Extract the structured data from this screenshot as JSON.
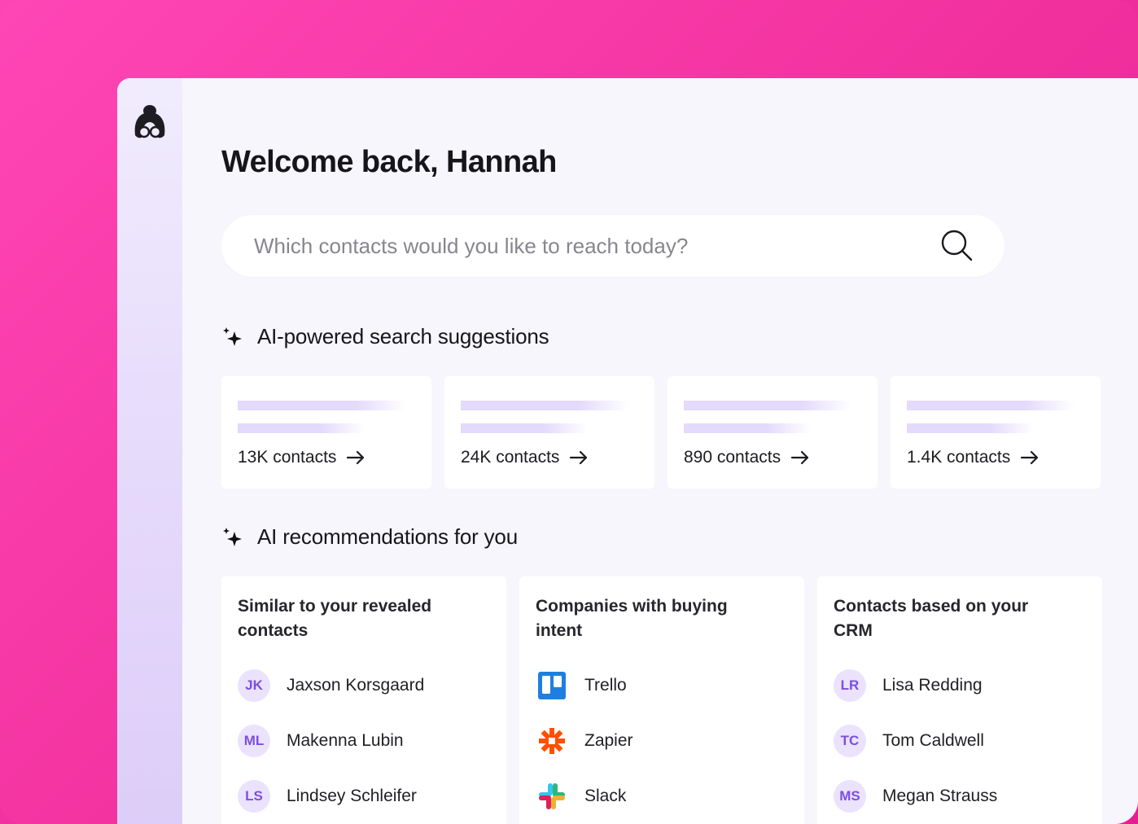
{
  "greeting": "Welcome back, Hannah",
  "search": {
    "placeholder": "Which contacts would you like to reach today?",
    "icon": "search-icon"
  },
  "suggestions": {
    "heading": "AI-powered search suggestions",
    "cards": [
      {
        "label": "13K contacts"
      },
      {
        "label": "24K contacts"
      },
      {
        "label": "890 contacts"
      },
      {
        "label": "1.4K contacts"
      }
    ]
  },
  "recommendations": {
    "heading": "AI recommendations for you",
    "columns": [
      {
        "title": "Similar to your revealed contacts",
        "items": [
          {
            "initials": "JK",
            "name": "Jaxson Korsgaard"
          },
          {
            "initials": "ML",
            "name": "Makenna Lubin"
          },
          {
            "initials": "LS",
            "name": "Lindsey Schleifer"
          }
        ]
      },
      {
        "title": "Companies with buying intent",
        "items": [
          {
            "icon": "trello-logo-icon",
            "name": "Trello"
          },
          {
            "icon": "zapier-logo-icon",
            "name": "Zapier"
          },
          {
            "icon": "slack-logo-icon",
            "name": "Slack"
          }
        ]
      },
      {
        "title": "Contacts based on your CRM",
        "items": [
          {
            "initials": "LR",
            "name": "Lisa Redding"
          },
          {
            "initials": "TC",
            "name": "Tom Caldwell"
          },
          {
            "initials": "MS",
            "name": "Megan Strauss"
          }
        ]
      }
    ]
  },
  "colors": {
    "background_pink": "#f0309e",
    "sidebar_lavender": "#e5d9fb",
    "avatar_bg": "#ebe2fd",
    "avatar_text": "#7c4fe0",
    "trello_blue": "#1f7fe0",
    "zapier_orange": "#ff4f00"
  }
}
